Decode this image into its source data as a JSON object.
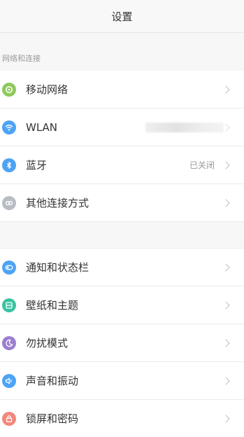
{
  "header": {
    "title": "设置"
  },
  "sections": {
    "network": {
      "label": "网络和连接",
      "items": [
        {
          "label": "移动网络",
          "value": "",
          "icon": "mobile-network-icon",
          "color": "#8fc95c"
        },
        {
          "label": "WLAN",
          "value": "",
          "icon": "wifi-icon",
          "color": "#4da3f5"
        },
        {
          "label": "蓝牙",
          "value": "已关闭",
          "icon": "bluetooth-icon",
          "color": "#4da3f5"
        },
        {
          "label": "其他连接方式",
          "value": "",
          "icon": "link-icon",
          "color": "#b8bcc4"
        }
      ]
    },
    "display": {
      "items": [
        {
          "label": "通知和状态栏",
          "icon": "toggle-icon",
          "color": "#4da3f5"
        },
        {
          "label": "壁纸和主题",
          "icon": "theme-icon",
          "color": "#38c4a0"
        },
        {
          "label": "勿扰模式",
          "icon": "moon-icon",
          "color": "#9b7fd0"
        },
        {
          "label": "声音和振动",
          "icon": "speaker-icon",
          "color": "#4da3f5"
        },
        {
          "label": "锁屏和密码",
          "icon": "lock-icon",
          "color": "#f2877a"
        }
      ]
    }
  }
}
